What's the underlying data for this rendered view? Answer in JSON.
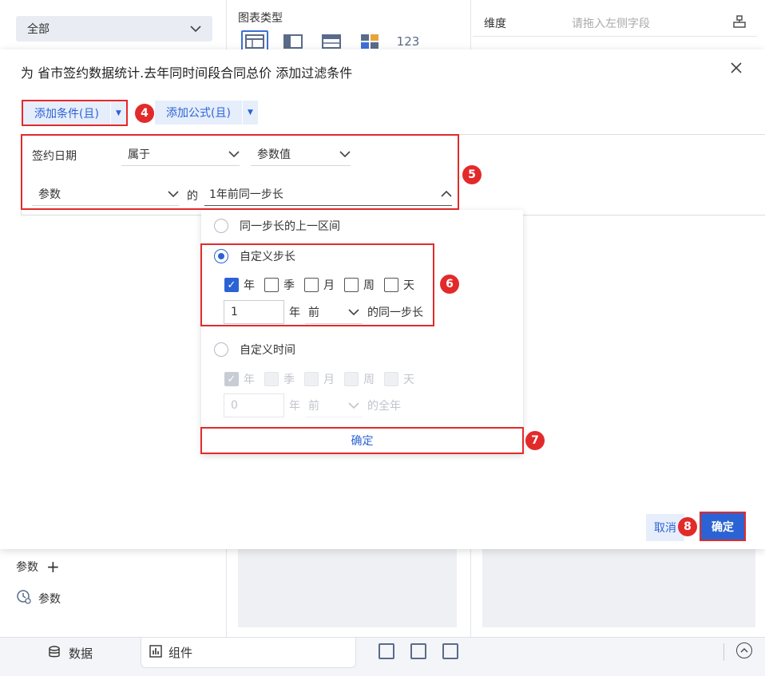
{
  "background": {
    "scope_select": "全部",
    "chart_type_label": "图表类型",
    "chart_type_text_icon": "123",
    "dimension_label": "维度",
    "dimension_placeholder": "请拖入左侧字段",
    "param_header": "参数",
    "param_item": "参数",
    "tabs": {
      "data": "数据",
      "components": "组件"
    }
  },
  "modal": {
    "title": "为 省市签约数据统计.去年同时间段合同总价 添加过滤条件",
    "add_condition": "添加条件(且)",
    "add_formula": "添加公式(且)",
    "condition": {
      "field": "签约日期",
      "operator": "属于",
      "value_type": "参数值",
      "param": "参数",
      "of_text": "的",
      "range_value": "1年前同一步长"
    },
    "dropdown": {
      "option1": "同一步长的上一区间",
      "option2": "自定义步长",
      "option3": "自定义时间",
      "units": [
        "年",
        "季",
        "月",
        "周",
        "天"
      ],
      "custom_step_value": "1",
      "custom_step_unit": "年",
      "custom_step_dir": "前",
      "custom_step_suffix": "的同一步长",
      "custom_time_value": "0",
      "custom_time_unit": "年",
      "custom_time_dir": "前",
      "custom_time_suffix": "的全年",
      "confirm": "确定"
    },
    "cancel": "取消",
    "confirm": "确定"
  },
  "badges": {
    "b4": "4",
    "b5": "5",
    "b6": "6",
    "b7": "7",
    "b8": "8"
  },
  "colors": {
    "accent": "#2c63d4",
    "highlight": "#e32a2a"
  }
}
